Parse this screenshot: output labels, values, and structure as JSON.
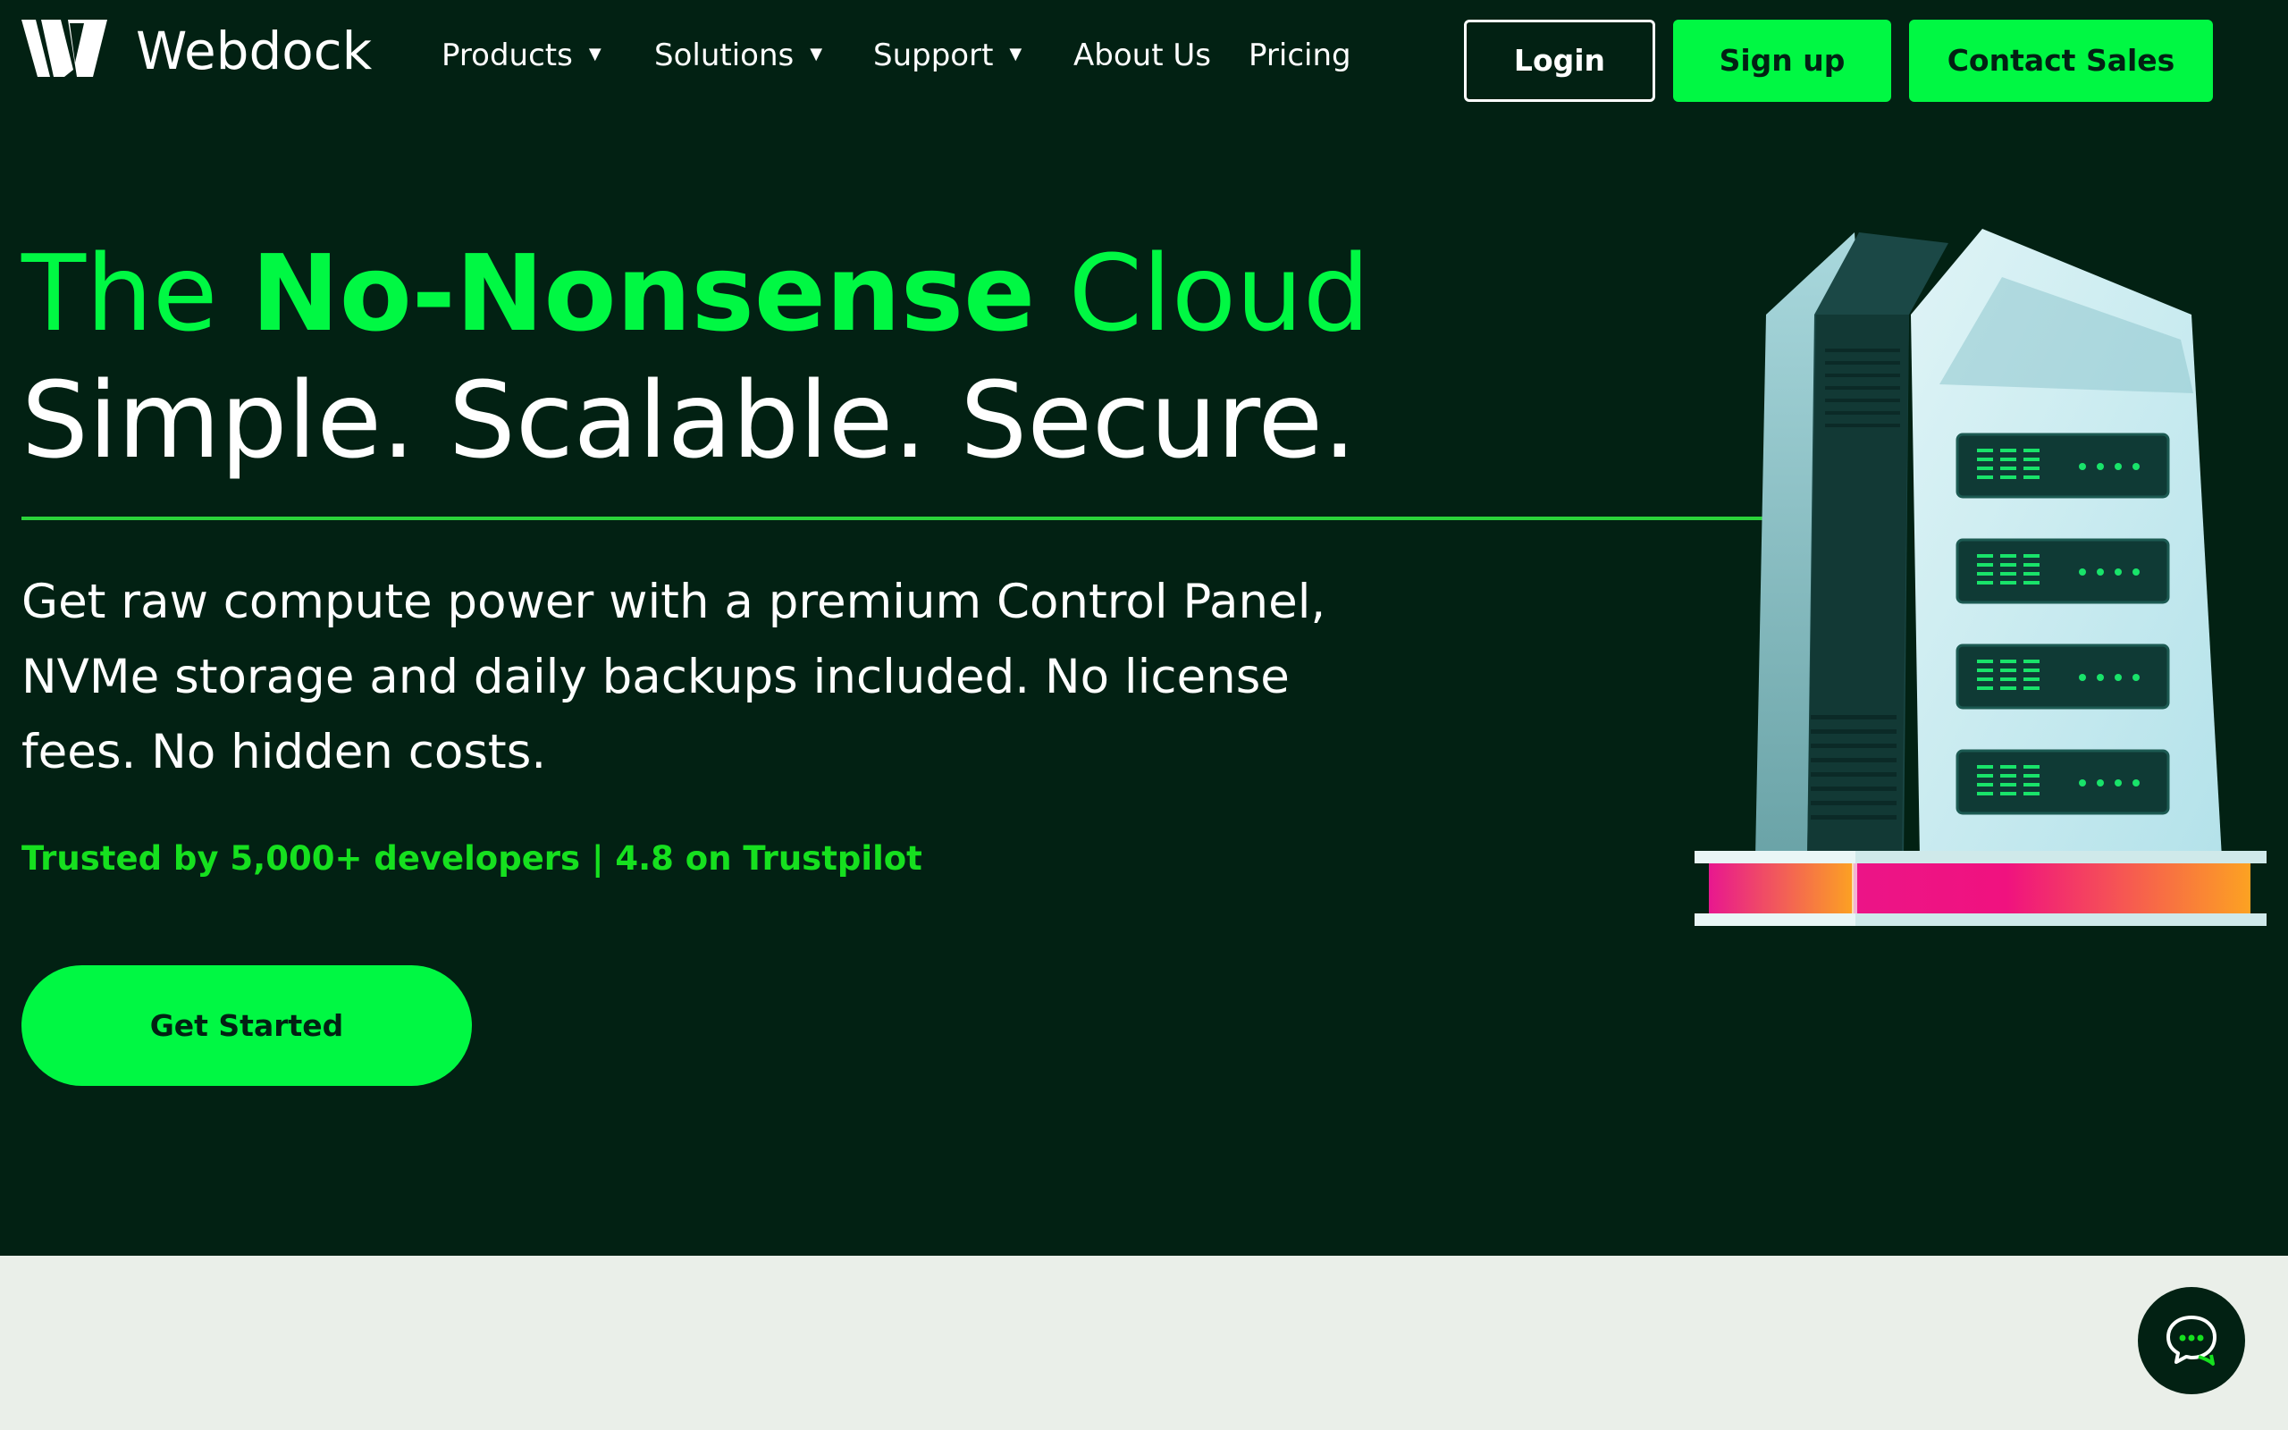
{
  "brand": {
    "name": "Webdock",
    "accent_color": "#00f843",
    "background_color": "#022113"
  },
  "nav": {
    "items": [
      {
        "label": "Products",
        "has_dropdown": true
      },
      {
        "label": "Solutions",
        "has_dropdown": true
      },
      {
        "label": "Support",
        "has_dropdown": true
      },
      {
        "label": "About Us",
        "has_dropdown": false
      },
      {
        "label": "Pricing",
        "has_dropdown": false
      }
    ],
    "login_label": "Login",
    "signup_label": "Sign up",
    "contact_label": "Contact Sales",
    "dropdown_caret": "▼"
  },
  "hero": {
    "headline_part1": "The ",
    "headline_strong": "No-Nonsense",
    "headline_part2": " Cloud",
    "subheadline": "Simple. Scalable. Secure.",
    "description": "Get raw compute power with a premium Control Panel, NVMe storage and daily backups included. No license fees. No hidden costs.",
    "trust_line": "Trusted by 5,000+ developers | 4.8 on Trustpilot",
    "cta_label": "Get Started"
  },
  "icons": {
    "logo": "webdock-logo-icon",
    "illustration": "server-tower-illustration",
    "chat": "chat-bubble-icon"
  }
}
